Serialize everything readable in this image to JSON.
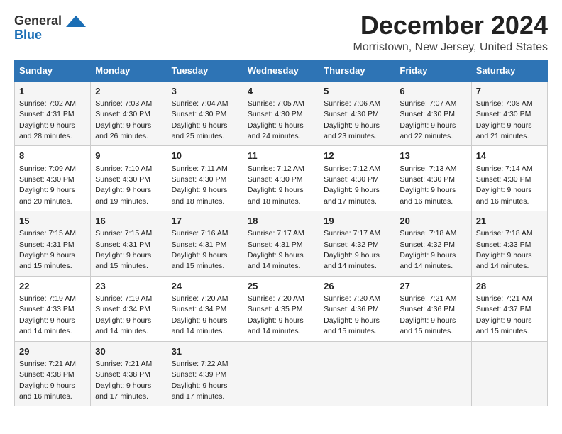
{
  "logo": {
    "line1": "General",
    "line2": "Blue",
    "icon_color": "#1a6eb5"
  },
  "title": "December 2024",
  "subtitle": "Morristown, New Jersey, United States",
  "days_header": [
    "Sunday",
    "Monday",
    "Tuesday",
    "Wednesday",
    "Thursday",
    "Friday",
    "Saturday"
  ],
  "weeks": [
    [
      {
        "day": "1",
        "info": "Sunrise: 7:02 AM\nSunset: 4:31 PM\nDaylight: 9 hours\nand 28 minutes."
      },
      {
        "day": "2",
        "info": "Sunrise: 7:03 AM\nSunset: 4:30 PM\nDaylight: 9 hours\nand 26 minutes."
      },
      {
        "day": "3",
        "info": "Sunrise: 7:04 AM\nSunset: 4:30 PM\nDaylight: 9 hours\nand 25 minutes."
      },
      {
        "day": "4",
        "info": "Sunrise: 7:05 AM\nSunset: 4:30 PM\nDaylight: 9 hours\nand 24 minutes."
      },
      {
        "day": "5",
        "info": "Sunrise: 7:06 AM\nSunset: 4:30 PM\nDaylight: 9 hours\nand 23 minutes."
      },
      {
        "day": "6",
        "info": "Sunrise: 7:07 AM\nSunset: 4:30 PM\nDaylight: 9 hours\nand 22 minutes."
      },
      {
        "day": "7",
        "info": "Sunrise: 7:08 AM\nSunset: 4:30 PM\nDaylight: 9 hours\nand 21 minutes."
      }
    ],
    [
      {
        "day": "8",
        "info": "Sunrise: 7:09 AM\nSunset: 4:30 PM\nDaylight: 9 hours\nand 20 minutes."
      },
      {
        "day": "9",
        "info": "Sunrise: 7:10 AM\nSunset: 4:30 PM\nDaylight: 9 hours\nand 19 minutes."
      },
      {
        "day": "10",
        "info": "Sunrise: 7:11 AM\nSunset: 4:30 PM\nDaylight: 9 hours\nand 18 minutes."
      },
      {
        "day": "11",
        "info": "Sunrise: 7:12 AM\nSunset: 4:30 PM\nDaylight: 9 hours\nand 18 minutes."
      },
      {
        "day": "12",
        "info": "Sunrise: 7:12 AM\nSunset: 4:30 PM\nDaylight: 9 hours\nand 17 minutes."
      },
      {
        "day": "13",
        "info": "Sunrise: 7:13 AM\nSunset: 4:30 PM\nDaylight: 9 hours\nand 16 minutes."
      },
      {
        "day": "14",
        "info": "Sunrise: 7:14 AM\nSunset: 4:30 PM\nDaylight: 9 hours\nand 16 minutes."
      }
    ],
    [
      {
        "day": "15",
        "info": "Sunrise: 7:15 AM\nSunset: 4:31 PM\nDaylight: 9 hours\nand 15 minutes."
      },
      {
        "day": "16",
        "info": "Sunrise: 7:15 AM\nSunset: 4:31 PM\nDaylight: 9 hours\nand 15 minutes."
      },
      {
        "day": "17",
        "info": "Sunrise: 7:16 AM\nSunset: 4:31 PM\nDaylight: 9 hours\nand 15 minutes."
      },
      {
        "day": "18",
        "info": "Sunrise: 7:17 AM\nSunset: 4:31 PM\nDaylight: 9 hours\nand 14 minutes."
      },
      {
        "day": "19",
        "info": "Sunrise: 7:17 AM\nSunset: 4:32 PM\nDaylight: 9 hours\nand 14 minutes."
      },
      {
        "day": "20",
        "info": "Sunrise: 7:18 AM\nSunset: 4:32 PM\nDaylight: 9 hours\nand 14 minutes."
      },
      {
        "day": "21",
        "info": "Sunrise: 7:18 AM\nSunset: 4:33 PM\nDaylight: 9 hours\nand 14 minutes."
      }
    ],
    [
      {
        "day": "22",
        "info": "Sunrise: 7:19 AM\nSunset: 4:33 PM\nDaylight: 9 hours\nand 14 minutes."
      },
      {
        "day": "23",
        "info": "Sunrise: 7:19 AM\nSunset: 4:34 PM\nDaylight: 9 hours\nand 14 minutes."
      },
      {
        "day": "24",
        "info": "Sunrise: 7:20 AM\nSunset: 4:34 PM\nDaylight: 9 hours\nand 14 minutes."
      },
      {
        "day": "25",
        "info": "Sunrise: 7:20 AM\nSunset: 4:35 PM\nDaylight: 9 hours\nand 14 minutes."
      },
      {
        "day": "26",
        "info": "Sunrise: 7:20 AM\nSunset: 4:36 PM\nDaylight: 9 hours\nand 15 minutes."
      },
      {
        "day": "27",
        "info": "Sunrise: 7:21 AM\nSunset: 4:36 PM\nDaylight: 9 hours\nand 15 minutes."
      },
      {
        "day": "28",
        "info": "Sunrise: 7:21 AM\nSunset: 4:37 PM\nDaylight: 9 hours\nand 15 minutes."
      }
    ],
    [
      {
        "day": "29",
        "info": "Sunrise: 7:21 AM\nSunset: 4:38 PM\nDaylight: 9 hours\nand 16 minutes."
      },
      {
        "day": "30",
        "info": "Sunrise: 7:21 AM\nSunset: 4:38 PM\nDaylight: 9 hours\nand 17 minutes."
      },
      {
        "day": "31",
        "info": "Sunrise: 7:22 AM\nSunset: 4:39 PM\nDaylight: 9 hours\nand 17 minutes."
      },
      null,
      null,
      null,
      null
    ]
  ]
}
